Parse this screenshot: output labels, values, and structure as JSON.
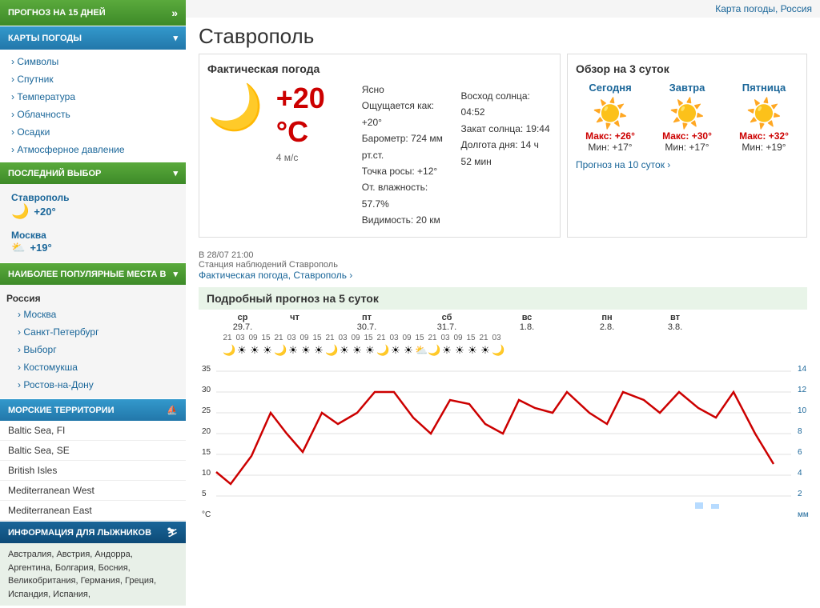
{
  "sidebar": {
    "forecast_btn": "ПРОГНОЗ НА 15 ДНЕЙ",
    "maps_btn": "КАРТЫ ПОГОДЫ",
    "maps_items": [
      "Символы",
      "Спутник",
      "Температура",
      "Облачность",
      "Осадки",
      "Атмосферное давление"
    ],
    "last_choice_header": "ПОСЛЕДНИЙ ВЫБОР",
    "cities": [
      {
        "name": "Ставрополь",
        "temp": "+20°",
        "icon": "moon"
      },
      {
        "name": "Москва",
        "temp": "+19°",
        "icon": "cloud"
      }
    ],
    "popular_header": "НАИБОЛЕЕ ПОПУЛЯРНЫЕ МЕСТА В",
    "popular_region": "Россия",
    "popular_items": [
      "Москва",
      "Санкт-Петербург",
      "Выборг",
      "Костомукша",
      "Ростов-на-Дону"
    ],
    "marine_header": "МОРСКИЕ ТЕРРИТОРИИ",
    "marine_items": [
      {
        "name": "Baltic Sea, FI",
        "active": false
      },
      {
        "name": "Baltic Sea, SE",
        "active": false
      },
      {
        "name": "British Isles",
        "active": false
      },
      {
        "name": "Mediterranean West",
        "active": false
      },
      {
        "name": "Mediterranean East",
        "active": false
      }
    ],
    "ski_header": "ИНФОРМАЦИЯ ДЛЯ ЛЫЖНИКОВ",
    "ski_content": "Австралия, Австрия, Андорра, Аргентина, Болгария, Босния, Великобритания, Германия, Греция, Испандия, Испания,"
  },
  "header": {
    "top_link": "Карта погоды, Россия",
    "city_title": "Ставрополь"
  },
  "current_weather": {
    "title": "Фактическая погода",
    "temp": "+20 °C",
    "wind": "4 м/с",
    "condition": "Ясно",
    "feels_like": "Ощущается как: +20°",
    "pressure": "Барометр: 724 мм рт.ст.",
    "dew_point": "Точка росы: +12°",
    "humidity": "От. влажность: 57.7%",
    "visibility": "Видимость: 20 км",
    "sunrise": "Восход солнца: 04:52",
    "sunset": "Закат солнца: 19:44",
    "daylight": "Долгота дня: 14 ч 52 мин",
    "timestamp": "В 28/07 21:00",
    "station": "Станция наблюдений Ставрополь",
    "actual_link": "Фактическая погода, Ставрополь ›"
  },
  "overview": {
    "title": "Обзор на 3 суток",
    "days": [
      {
        "name": "Сегодня",
        "max": "Макс: +26°",
        "min": "Мин: +17°",
        "icon": "sun"
      },
      {
        "name": "Завтра",
        "max": "Макс: +30°",
        "min": "Мин: +17°",
        "icon": "sun"
      },
      {
        "name": "Пятница",
        "max": "Макс: +32°",
        "min": "Мин: +19°",
        "icon": "sun"
      }
    ],
    "forecast_link": "Прогноз на 10 суток ›"
  },
  "forecast": {
    "title": "Подробный прогноз на 5 суток",
    "days": [
      {
        "day": "ср",
        "date": "29.7.",
        "times": [
          "21",
          "03",
          "09",
          "15"
        ]
      },
      {
        "day": "чт",
        "date": "",
        "times": []
      },
      {
        "day": "пт",
        "date": "30.7.",
        "times": [
          "21",
          "03",
          "09",
          "15"
        ]
      },
      {
        "day": "сб",
        "date": "31.7.",
        "times": [
          "21",
          "03",
          "09",
          "15"
        ]
      },
      {
        "day": "вс",
        "date": "1.8.",
        "times": [
          "21",
          "03",
          "09",
          "15"
        ]
      },
      {
        "day": "пн",
        "date": "2.8.",
        "times": [
          "21",
          "03",
          "09",
          "15"
        ]
      },
      {
        "day": "вт",
        "date": "3.8.",
        "times": [
          "21",
          "03"
        ]
      }
    ],
    "y_axis_left": [
      "35",
      "30",
      "25",
      "20",
      "15",
      "10",
      "5",
      "°C"
    ],
    "y_axis_right": [
      "14",
      "12",
      "10",
      "8",
      "6",
      "4",
      "2",
      "мм"
    ]
  }
}
